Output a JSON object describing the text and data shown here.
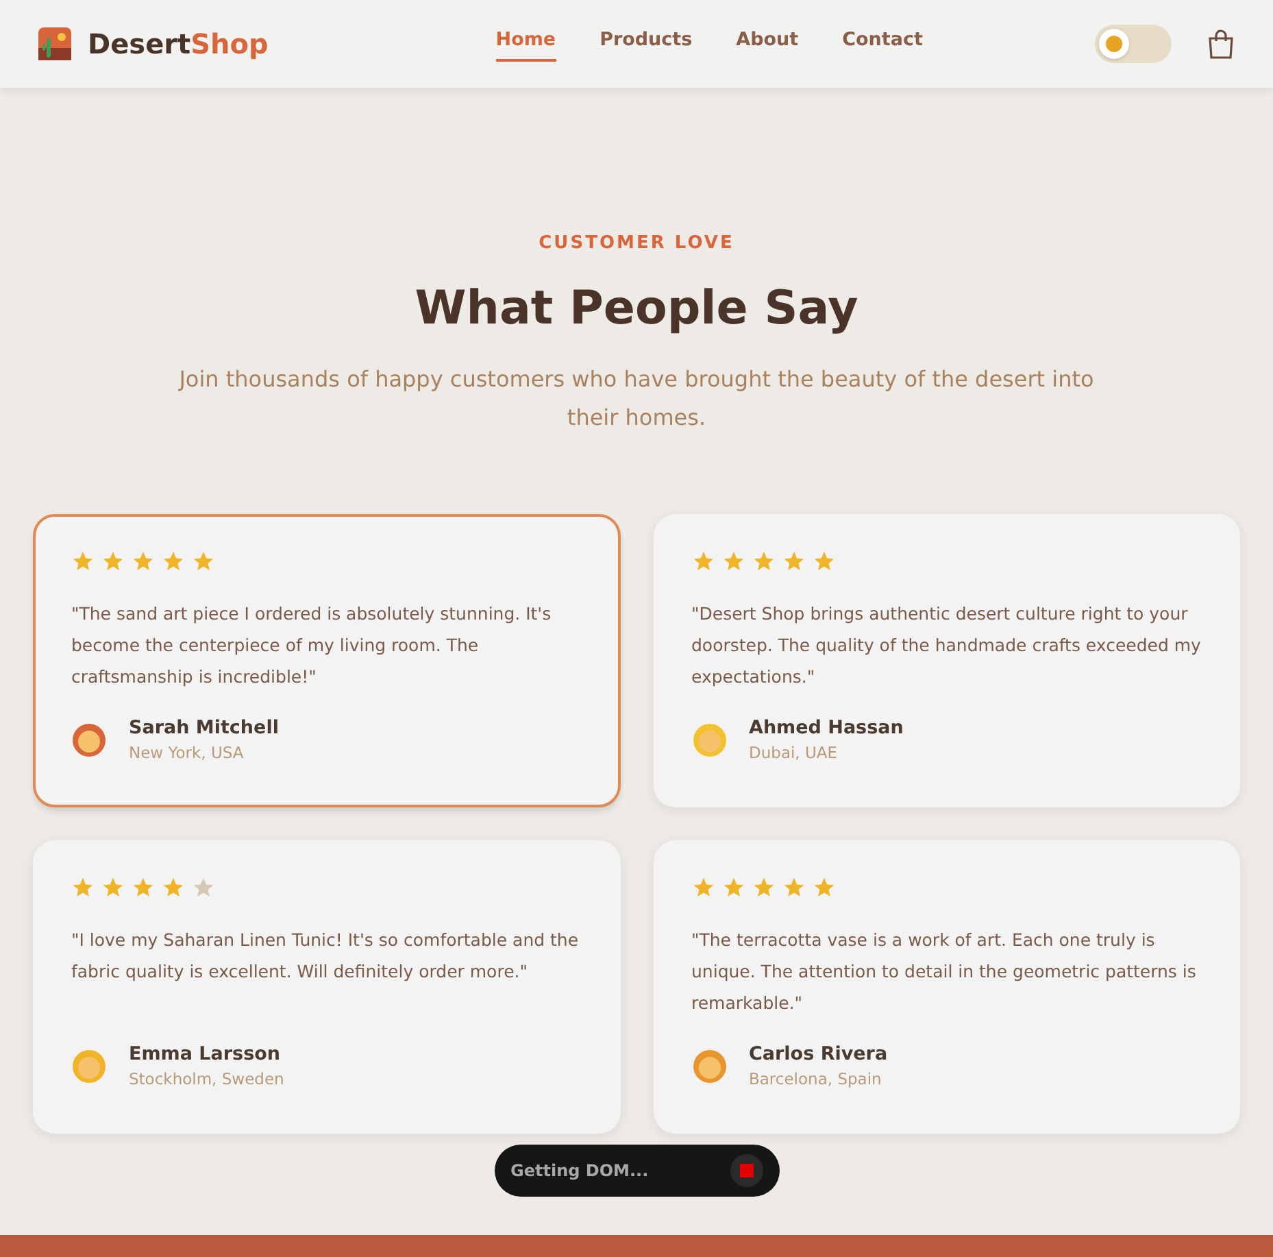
{
  "header": {
    "brand": {
      "name": "Desert",
      "accent": "Shop"
    },
    "nav": [
      {
        "label": "Home",
        "selected": true
      },
      {
        "label": "Products",
        "selected": false
      },
      {
        "label": "About",
        "selected": false
      },
      {
        "label": "Contact",
        "selected": false
      }
    ],
    "theme_toggle": {
      "on": false
    }
  },
  "section": {
    "eyebrow": "CUSTOMER LOVE",
    "title": "What People Say",
    "subtitle": "Join thousands of happy customers who have brought the beauty of the desert into their homes."
  },
  "testimonials": [
    {
      "stars": 5,
      "highlighted": true,
      "quote": "\"The sand art piece I ordered is absolutely stunning. It's become the centerpiece of my living room. The craftsmanship is incredible!\"",
      "name": "Sarah Mitchell",
      "location": "New York, USA",
      "color": "#d9663a"
    },
    {
      "stars": 5,
      "highlighted": false,
      "quote": "\"Desert Shop brings authentic desert culture right to your doorstep. The quality of the handmade crafts exceeded my expectations.\"",
      "name": "Ahmed Hassan",
      "location": "Dubai, UAE",
      "color": "#f2c230"
    },
    {
      "stars": 4,
      "highlighted": false,
      "quote": "\"I love my Saharan Linen Tunic! It's so comfortable and the fabric quality is excellent. Will definitely order more.\"",
      "name": "Emma Larsson",
      "location": "Stockholm, Sweden",
      "color": "#f0b429"
    },
    {
      "stars": 5,
      "highlighted": false,
      "quote": "\"The terracotta vase is a work of art. Each one truly is unique. The attention to detail in the geometric patterns is remarkable.\"",
      "name": "Carlos Rivera",
      "location": "Barcelona, Spain",
      "color": "#e8962e"
    }
  ],
  "status_pill": {
    "text": "Getting DOM..."
  }
}
